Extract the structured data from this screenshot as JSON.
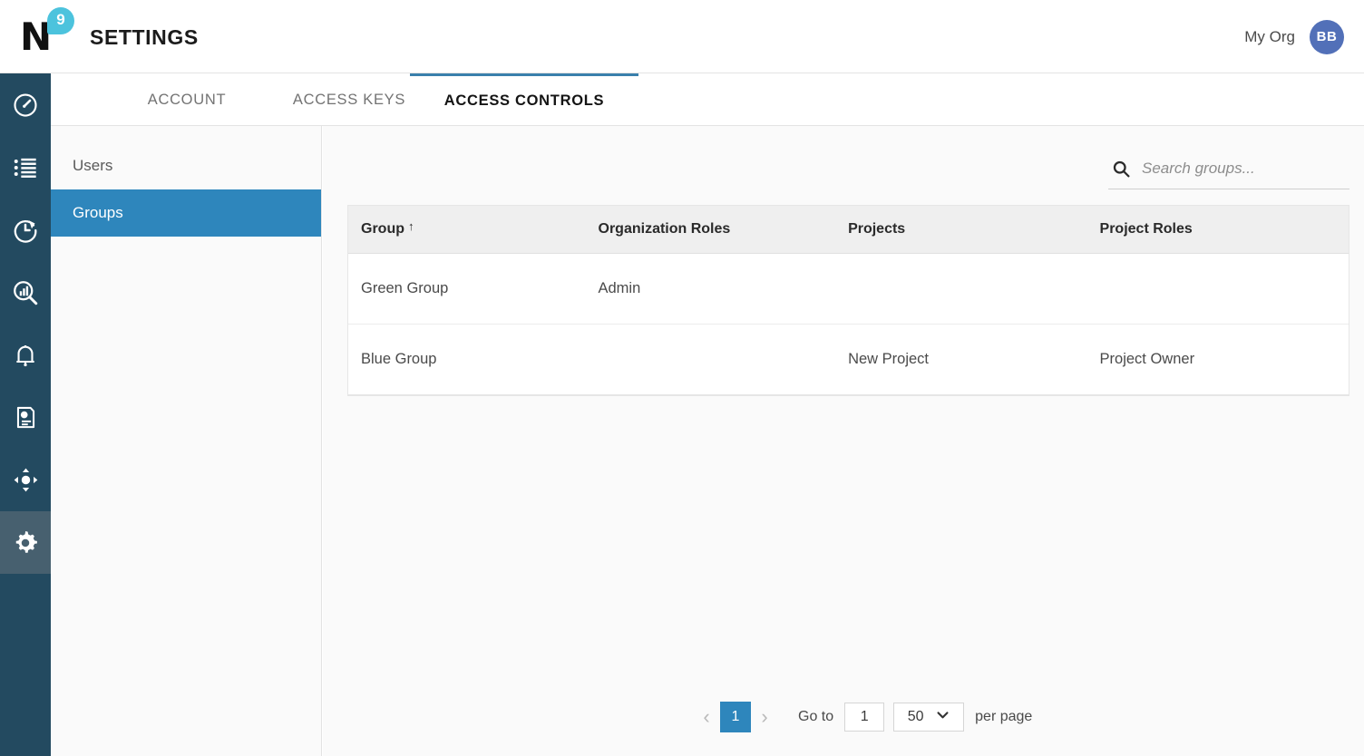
{
  "header": {
    "logo_letter": "N",
    "logo_badge": "9",
    "title": "SETTINGS",
    "org_label": "My Org",
    "avatar_initials": "BB",
    "accent_blue": "#2e86bc",
    "rail_bg": "#234a60",
    "logo_cyan": "#4cc3dd",
    "avatar_bg": "#5270b8"
  },
  "rail": {
    "items": [
      {
        "icon": "dashboard-gauge-icon",
        "active": false
      },
      {
        "icon": "list-icon",
        "active": false
      },
      {
        "icon": "refresh-clock-icon",
        "active": false
      },
      {
        "icon": "chart-search-icon",
        "active": false
      },
      {
        "icon": "bell-icon",
        "active": false
      },
      {
        "icon": "report-document-icon",
        "active": false
      },
      {
        "icon": "move-nodes-icon",
        "active": false
      },
      {
        "icon": "gear-icon",
        "active": true
      }
    ]
  },
  "tabs": [
    {
      "label": "ACCOUNT",
      "active": false
    },
    {
      "label": "ACCESS KEYS",
      "active": false
    },
    {
      "label": "ACCESS CONTROLS",
      "active": true
    }
  ],
  "subnav": {
    "items": [
      {
        "label": "Users",
        "active": false
      },
      {
        "label": "Groups",
        "active": true
      }
    ]
  },
  "search": {
    "placeholder": "Search groups...",
    "value": "",
    "icon": "search-icon"
  },
  "table": {
    "columns": [
      {
        "label": "Group",
        "sorted": true,
        "sort_arrow": "↑"
      },
      {
        "label": "Organization Roles",
        "sorted": false,
        "sort_arrow": ""
      },
      {
        "label": "Projects",
        "sorted": false,
        "sort_arrow": ""
      },
      {
        "label": "Project Roles",
        "sorted": false,
        "sort_arrow": ""
      }
    ],
    "rows": [
      {
        "group": "Green Group",
        "organization_roles": "Admin",
        "projects": "",
        "project_roles": ""
      },
      {
        "group": "Blue Group",
        "organization_roles": "",
        "projects": "New Project",
        "project_roles": "Project Owner"
      }
    ]
  },
  "pagination": {
    "prev_icon": "chevron-left-icon",
    "next_icon": "chevron-right-icon",
    "current_page": "1",
    "goto_label": "Go to",
    "goto_value": "1",
    "per_page_value": "50",
    "per_page_label": "per page",
    "chevron_icon": "chevron-down-icon"
  }
}
